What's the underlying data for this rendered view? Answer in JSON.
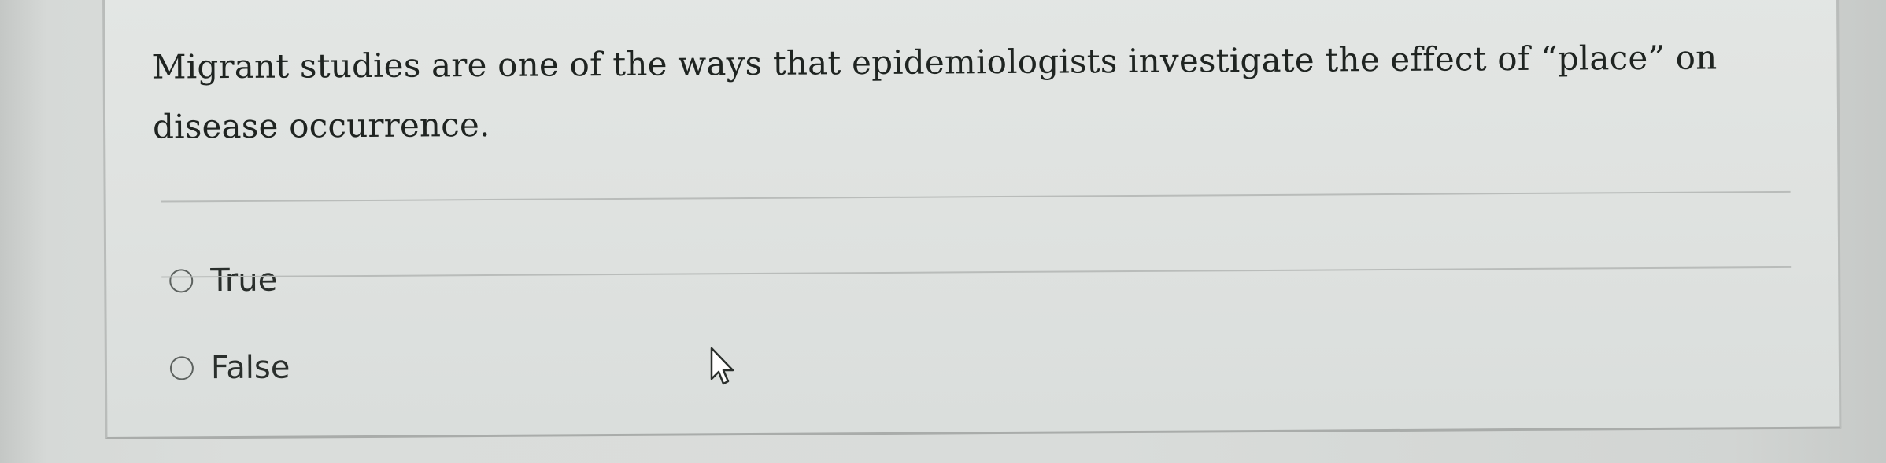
{
  "question": {
    "text": "Migrant studies are one of the ways that epidemiologists investigate the effect of “place” on disease occurrence."
  },
  "options": [
    {
      "label": "True",
      "selected": false
    },
    {
      "label": "False",
      "selected": false
    }
  ],
  "icons": {
    "radio": "radio-unchecked-icon",
    "cursor": "mouse-pointer-icon"
  },
  "colors": {
    "text": "#1f2421",
    "radio_border": "#5d625f",
    "card_background": "#e0e3e1"
  }
}
